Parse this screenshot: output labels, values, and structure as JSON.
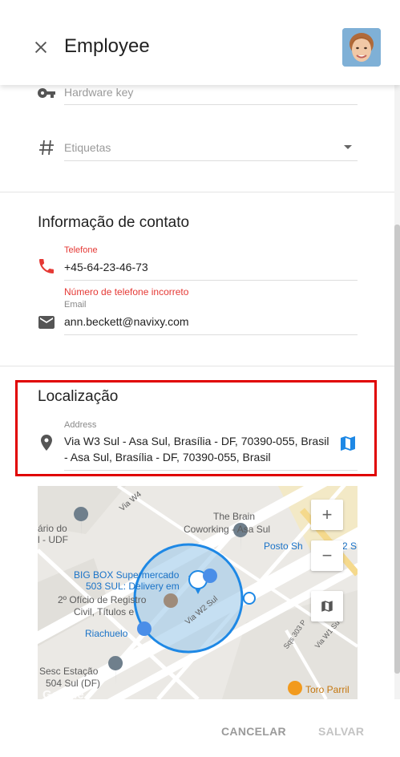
{
  "header": {
    "title": "Employee",
    "close_icon": "close-icon",
    "avatar": "employee-avatar"
  },
  "identity": {
    "hardware_key_placeholder": "Hardware key",
    "tags_placeholder": "Etiquetas"
  },
  "contact": {
    "section_title": "Informação de contato",
    "phone_label": "Telefone",
    "phone_value": "+45-64-23-46-73",
    "phone_error": "Número de telefone incorreto",
    "email_label": "Email",
    "email_value": "ann.beckett@navixy.com"
  },
  "location": {
    "section_title": "Localização",
    "address_label": "Address",
    "address_line1": "Via W3 Sul - Asa Sul, Brasília - DF, 70390-055, Brasil",
    "address_line2": "- Asa Sul, Brasília - DF, 70390-055, Brasil"
  },
  "map": {
    "labels": {
      "via_w4": "Via W4",
      "the_brain": "The Brain",
      "coworking": "Coworking - Asa Sul",
      "posto": "Posto Sh",
      "posto_tail": "2 S",
      "dario": "ário do",
      "udf": "l - UDF",
      "bigbox1": "BIG BOX Supermercado",
      "bigbox2": "503 SUL: Delivery em",
      "oficio1": "2º Ofício de Registro",
      "oficio2": "Civil, Títulos e",
      "riachuelo": "Riachuelo",
      "via_w2": "Via W2 Sul",
      "sqs303": "Sqs 303 P",
      "via_w1": "Via W1 Su",
      "sesc1": "Sesc Estação",
      "sesc2": "504 Sul (DF)",
      "toro": "Toro Parril",
      "google": "Google"
    },
    "zoom_in": "+",
    "zoom_out": "−"
  },
  "footer": {
    "cancel_label": "CANCELAR",
    "save_label": "SALVAR"
  },
  "colors": {
    "error": "#e53935",
    "accent": "#1e88e5",
    "highlight_box": "#e00000",
    "geofence_fill": "#9ec9ea",
    "geofence_stroke": "#1e88e5"
  }
}
